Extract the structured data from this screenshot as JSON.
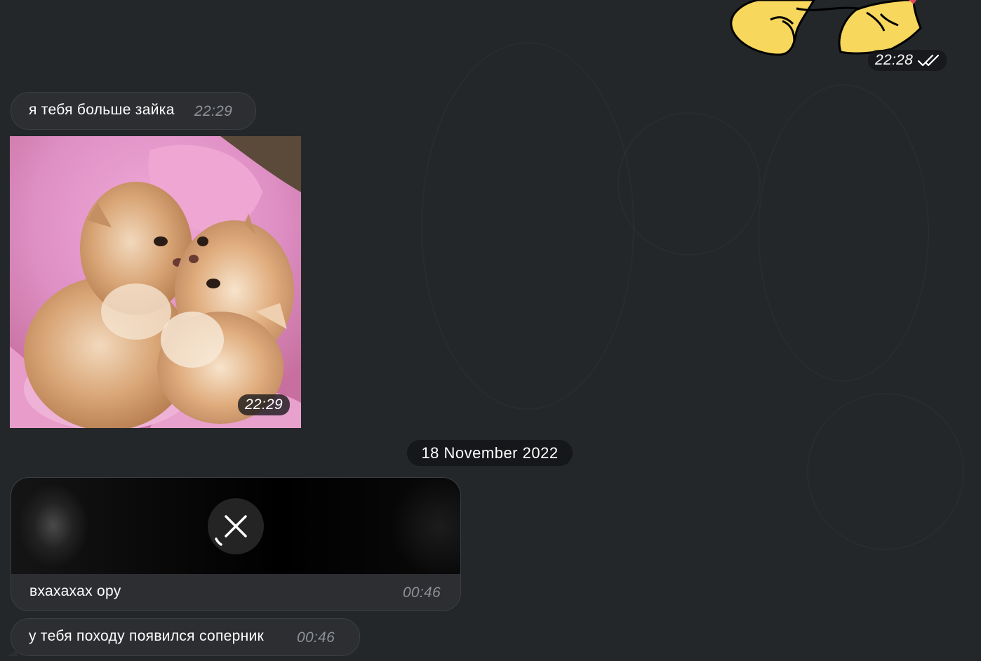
{
  "sticker_message": {
    "time": "22:28",
    "status_icon": "double-check-icon"
  },
  "text_message_1": {
    "text": "я тебя больше зайка",
    "time": "22:29"
  },
  "photo_message": {
    "time": "22:29"
  },
  "date_separator": {
    "label": "18 November 2022"
  },
  "video_message": {
    "caption": "вхахахах ору",
    "time": "00:46",
    "action_icon": "close-icon"
  },
  "text_message_2": {
    "text": "у тебя походу появился соперник",
    "time": "00:46"
  },
  "colors": {
    "background": "#24272a",
    "bubble": "#2c2e31",
    "bubble_border": "#3b3e42",
    "time_muted": "#8e9297",
    "sticker_yellow": "#f7d75c"
  }
}
